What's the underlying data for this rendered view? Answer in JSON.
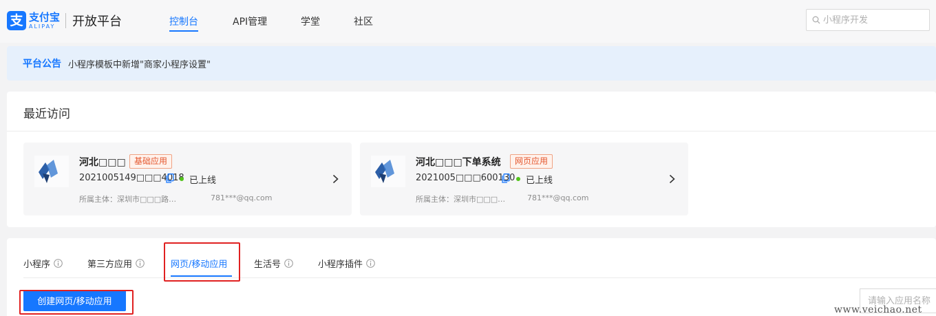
{
  "header": {
    "logo_mark": "支",
    "logo_cn": "支付宝",
    "logo_en": "ALIPAY",
    "platform_name": "开放平台",
    "nav": [
      {
        "label": "控制台",
        "active": true
      },
      {
        "label": "API管理",
        "active": false
      },
      {
        "label": "学堂",
        "active": false
      },
      {
        "label": "社区",
        "active": false
      }
    ],
    "search_placeholder": "小程序开发"
  },
  "notice": {
    "label": "平台公告",
    "text": "小程序模板中新增\"商家小程序设置\""
  },
  "recent": {
    "title": "最近访问",
    "cards": [
      {
        "name": "河北□□□",
        "tag": "基础应用",
        "app_id": "2021005149□□□4018",
        "status": "已上线",
        "owner": "所属主体：深圳市□□□路…",
        "email": "781***@qq.com"
      },
      {
        "name": "河北□□□下单系统",
        "tag": "网页应用",
        "app_id": "2021005□□□600130",
        "status": "已上线",
        "owner": "所属主体：深圳市□□□…",
        "email": "781***@qq.com"
      }
    ]
  },
  "apps": {
    "tabs": [
      {
        "label": "小程序",
        "active": false,
        "info": true
      },
      {
        "label": "第三方应用",
        "active": false,
        "info": true
      },
      {
        "label": "网页/移动应用",
        "active": true,
        "info": false
      },
      {
        "label": "生活号",
        "active": false,
        "info": true
      },
      {
        "label": "小程序插件",
        "active": false,
        "info": true
      }
    ],
    "create_button": "创建网页/移动应用",
    "name_search_placeholder": "请输入应用名称"
  },
  "colors": {
    "brand": "#1677ff",
    "highlight": "#e02020",
    "tag": "#e4572e",
    "status_online": "#52c41a"
  },
  "watermark": "www.veichao.net"
}
